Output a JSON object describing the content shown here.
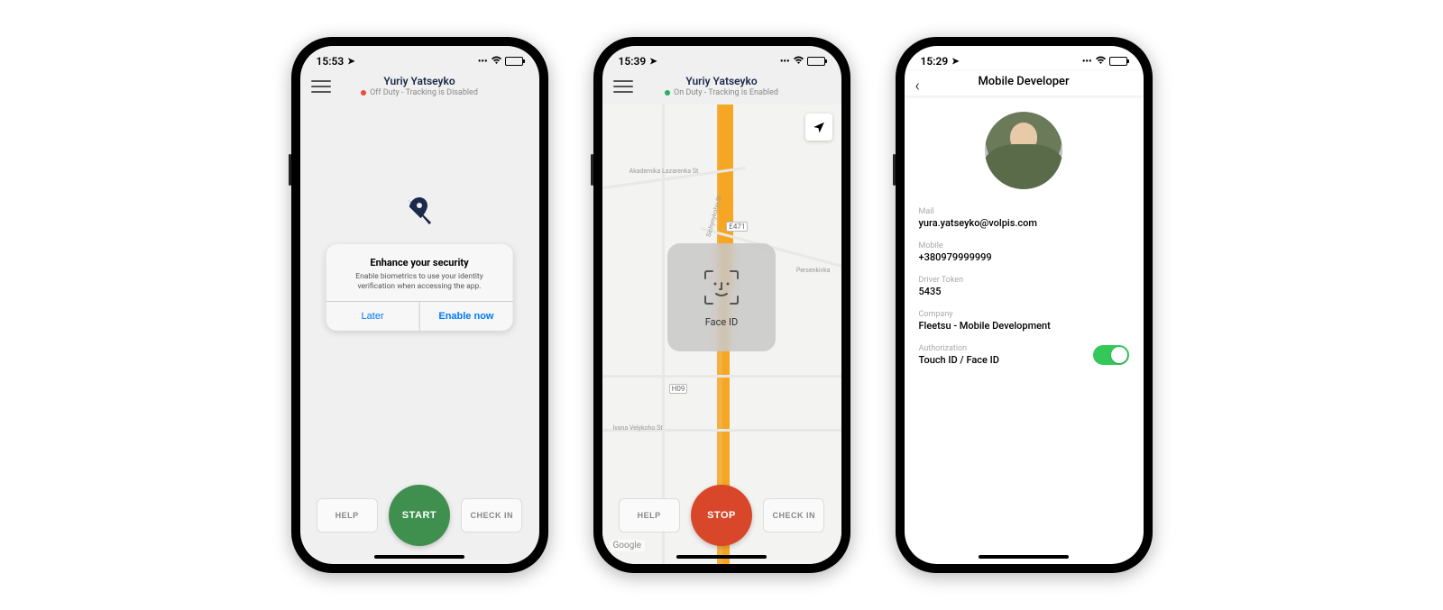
{
  "screen1": {
    "status": {
      "time": "15:53"
    },
    "header": {
      "title": "Yuriy Yatseyko",
      "subtitle": "Off Duty - Tracking is Disabled"
    },
    "alert": {
      "title": "Enhance your security",
      "message": "Enable biometrics to use your identity verification when accessing the app.",
      "later": "Later",
      "enable": "Enable now"
    },
    "buttons": {
      "help": "HELP",
      "main": "START",
      "checkin": "CHECK IN"
    }
  },
  "screen2": {
    "status": {
      "time": "15:39"
    },
    "header": {
      "title": "Yuriy Yatseyko",
      "subtitle": "On Duty - Tracking is Enabled"
    },
    "faceid": "Face ID",
    "buttons": {
      "help": "HELP",
      "main": "STOP",
      "checkin": "CHECK IN"
    },
    "map": {
      "streets": [
        "Akademika Lazarenka St",
        "Persenkivka",
        "Ivana Velykoho St",
        "Sichynykoho St"
      ],
      "markers": [
        "E471",
        "H09"
      ],
      "attribution": "Google"
    }
  },
  "screen3": {
    "status": {
      "time": "15:29"
    },
    "header": {
      "title": "Mobile Developer"
    },
    "fields": {
      "mail_label": "Mail",
      "mail_value": "yura.yatseyko@volpis.com",
      "mobile_label": "Mobile",
      "mobile_value": "+380979999999",
      "token_label": "Driver Token",
      "token_value": "5435",
      "company_label": "Company",
      "company_value": "Fleetsu - Mobile Development",
      "auth_label": "Authorization",
      "auth_value": "Touch ID / Face ID"
    }
  }
}
